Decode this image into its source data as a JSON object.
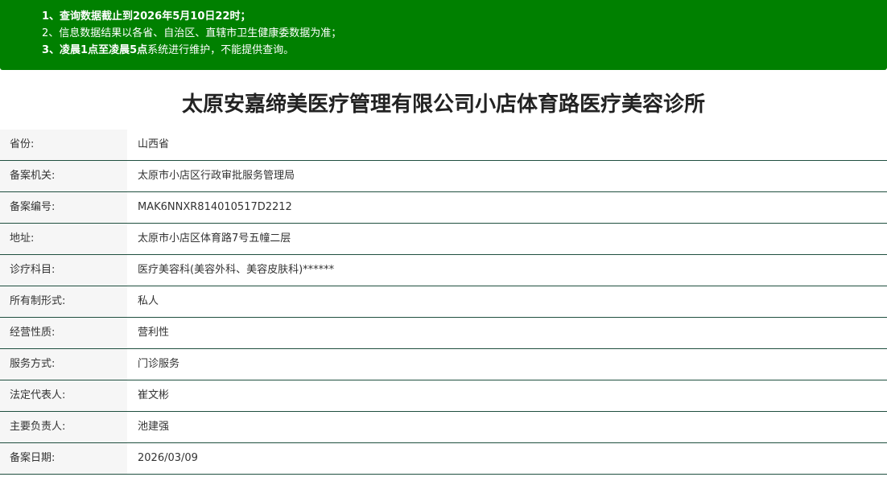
{
  "notice": {
    "line1": "1、查询数据截止到2026年5月10日22时；",
    "line2": "2、信息数据结果以各省、自治区、直辖市卫生健康委数据为准；",
    "line3_bold": "3、凌晨1点至凌晨5点",
    "line3_rest": "系统进行维护，不能提供查询。"
  },
  "title": "太原安嘉缔美医疗管理有限公司小店体育路医疗美容诊所",
  "rows": [
    {
      "label": "省份:",
      "value": "山西省"
    },
    {
      "label": "备案机关:",
      "value": "太原市小店区行政审批服务管理局"
    },
    {
      "label": "备案编号:",
      "value": "MAK6NNXR814010517D2212"
    },
    {
      "label": "地址:",
      "value": "太原市小店区体育路7号五幢二层"
    },
    {
      "label": "诊疗科目:",
      "value": "医疗美容科(美容外科、美容皮肤科)******"
    },
    {
      "label": "所有制形式:",
      "value": "私人"
    },
    {
      "label": "经营性质:",
      "value": "营利性"
    },
    {
      "label": "服务方式:",
      "value": "门诊服务"
    },
    {
      "label": "法定代表人:",
      "value": "崔文彬"
    },
    {
      "label": "主要负责人:",
      "value": "池建强"
    },
    {
      "label": "备案日期:",
      "value": "2026/03/09"
    }
  ]
}
